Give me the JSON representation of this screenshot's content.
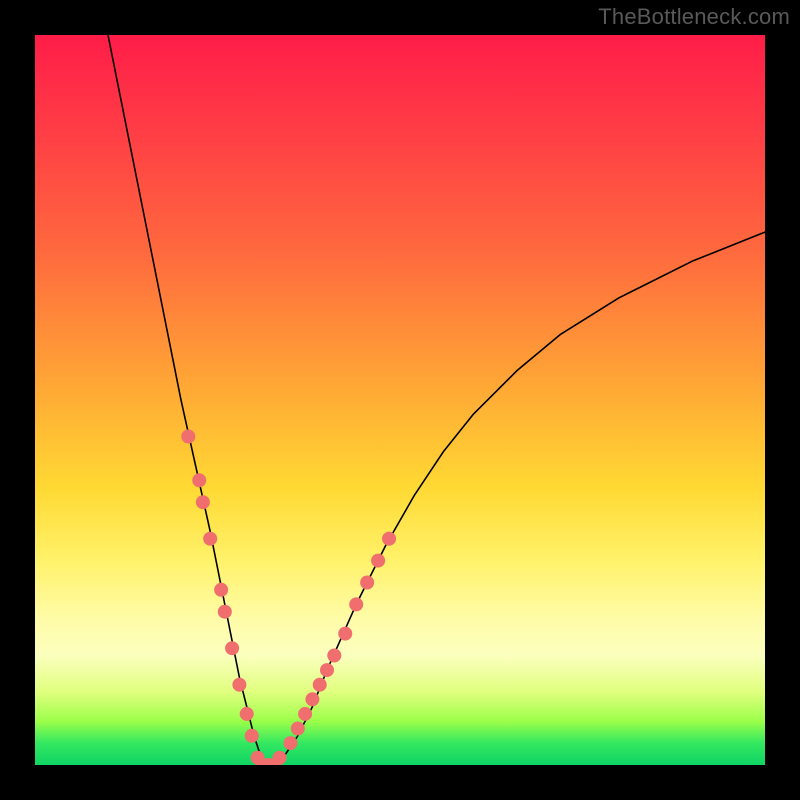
{
  "watermark": "TheBottleneck.com",
  "chart_data": {
    "type": "line",
    "title": "",
    "xlabel": "",
    "ylabel": "",
    "xlim": [
      0,
      100
    ],
    "ylim": [
      0,
      100
    ],
    "grid": false,
    "legend": false,
    "background": {
      "gradient_stops": [
        {
          "pos": 0.0,
          "color": "#ff1d48"
        },
        {
          "pos": 0.12,
          "color": "#ff3a46"
        },
        {
          "pos": 0.3,
          "color": "#ff6a3e"
        },
        {
          "pos": 0.48,
          "color": "#ffa735"
        },
        {
          "pos": 0.62,
          "color": "#ffd933"
        },
        {
          "pos": 0.72,
          "color": "#fff26a"
        },
        {
          "pos": 0.8,
          "color": "#fffca8"
        },
        {
          "pos": 0.85,
          "color": "#fbffbe"
        },
        {
          "pos": 0.9,
          "color": "#e0ff7e"
        },
        {
          "pos": 0.94,
          "color": "#9cff4a"
        },
        {
          "pos": 0.97,
          "color": "#34e860"
        },
        {
          "pos": 1.0,
          "color": "#0fd464"
        }
      ]
    },
    "series": [
      {
        "name": "bottleneck-curve",
        "stroke": "#000000",
        "stroke_width": 1.6,
        "x": [
          10,
          12,
          14,
          16,
          18,
          20,
          22,
          24,
          25,
          26,
          27,
          28,
          29,
          30,
          31,
          32,
          33,
          34,
          36,
          38,
          40,
          44,
          48,
          52,
          56,
          60,
          66,
          72,
          80,
          90,
          100
        ],
        "y": [
          100,
          90,
          80,
          70,
          60,
          50,
          41,
          32,
          27,
          22,
          17,
          12,
          8,
          4,
          1,
          0,
          0,
          1,
          4,
          8,
          13,
          22,
          30,
          37,
          43,
          48,
          54,
          59,
          64,
          69,
          73
        ]
      },
      {
        "name": "highlight-markers-left",
        "type": "scatter",
        "color": "#f06e6e",
        "radius_px": 7,
        "x": [
          21.0,
          22.5,
          23.0,
          24.0,
          25.5,
          26.0,
          27.0,
          28.0,
          29.0,
          29.7
        ],
        "y": [
          45,
          39,
          36,
          31,
          24,
          21,
          16,
          11,
          7,
          4
        ]
      },
      {
        "name": "highlight-markers-bottom",
        "type": "scatter",
        "color": "#f06e6e",
        "radius_px": 7,
        "x": [
          30.5,
          31.2,
          32.0,
          32.8,
          33.5
        ],
        "y": [
          1,
          0,
          0,
          0,
          1
        ]
      },
      {
        "name": "highlight-markers-right",
        "type": "scatter",
        "color": "#f06e6e",
        "radius_px": 7,
        "x": [
          35.0,
          36.0,
          37.0,
          38.0,
          39.0,
          40.0,
          41.0,
          42.5,
          44.0,
          45.5,
          47.0,
          48.5
        ],
        "y": [
          3,
          5,
          7,
          9,
          11,
          13,
          15,
          18,
          22,
          25,
          28,
          31
        ]
      }
    ]
  }
}
